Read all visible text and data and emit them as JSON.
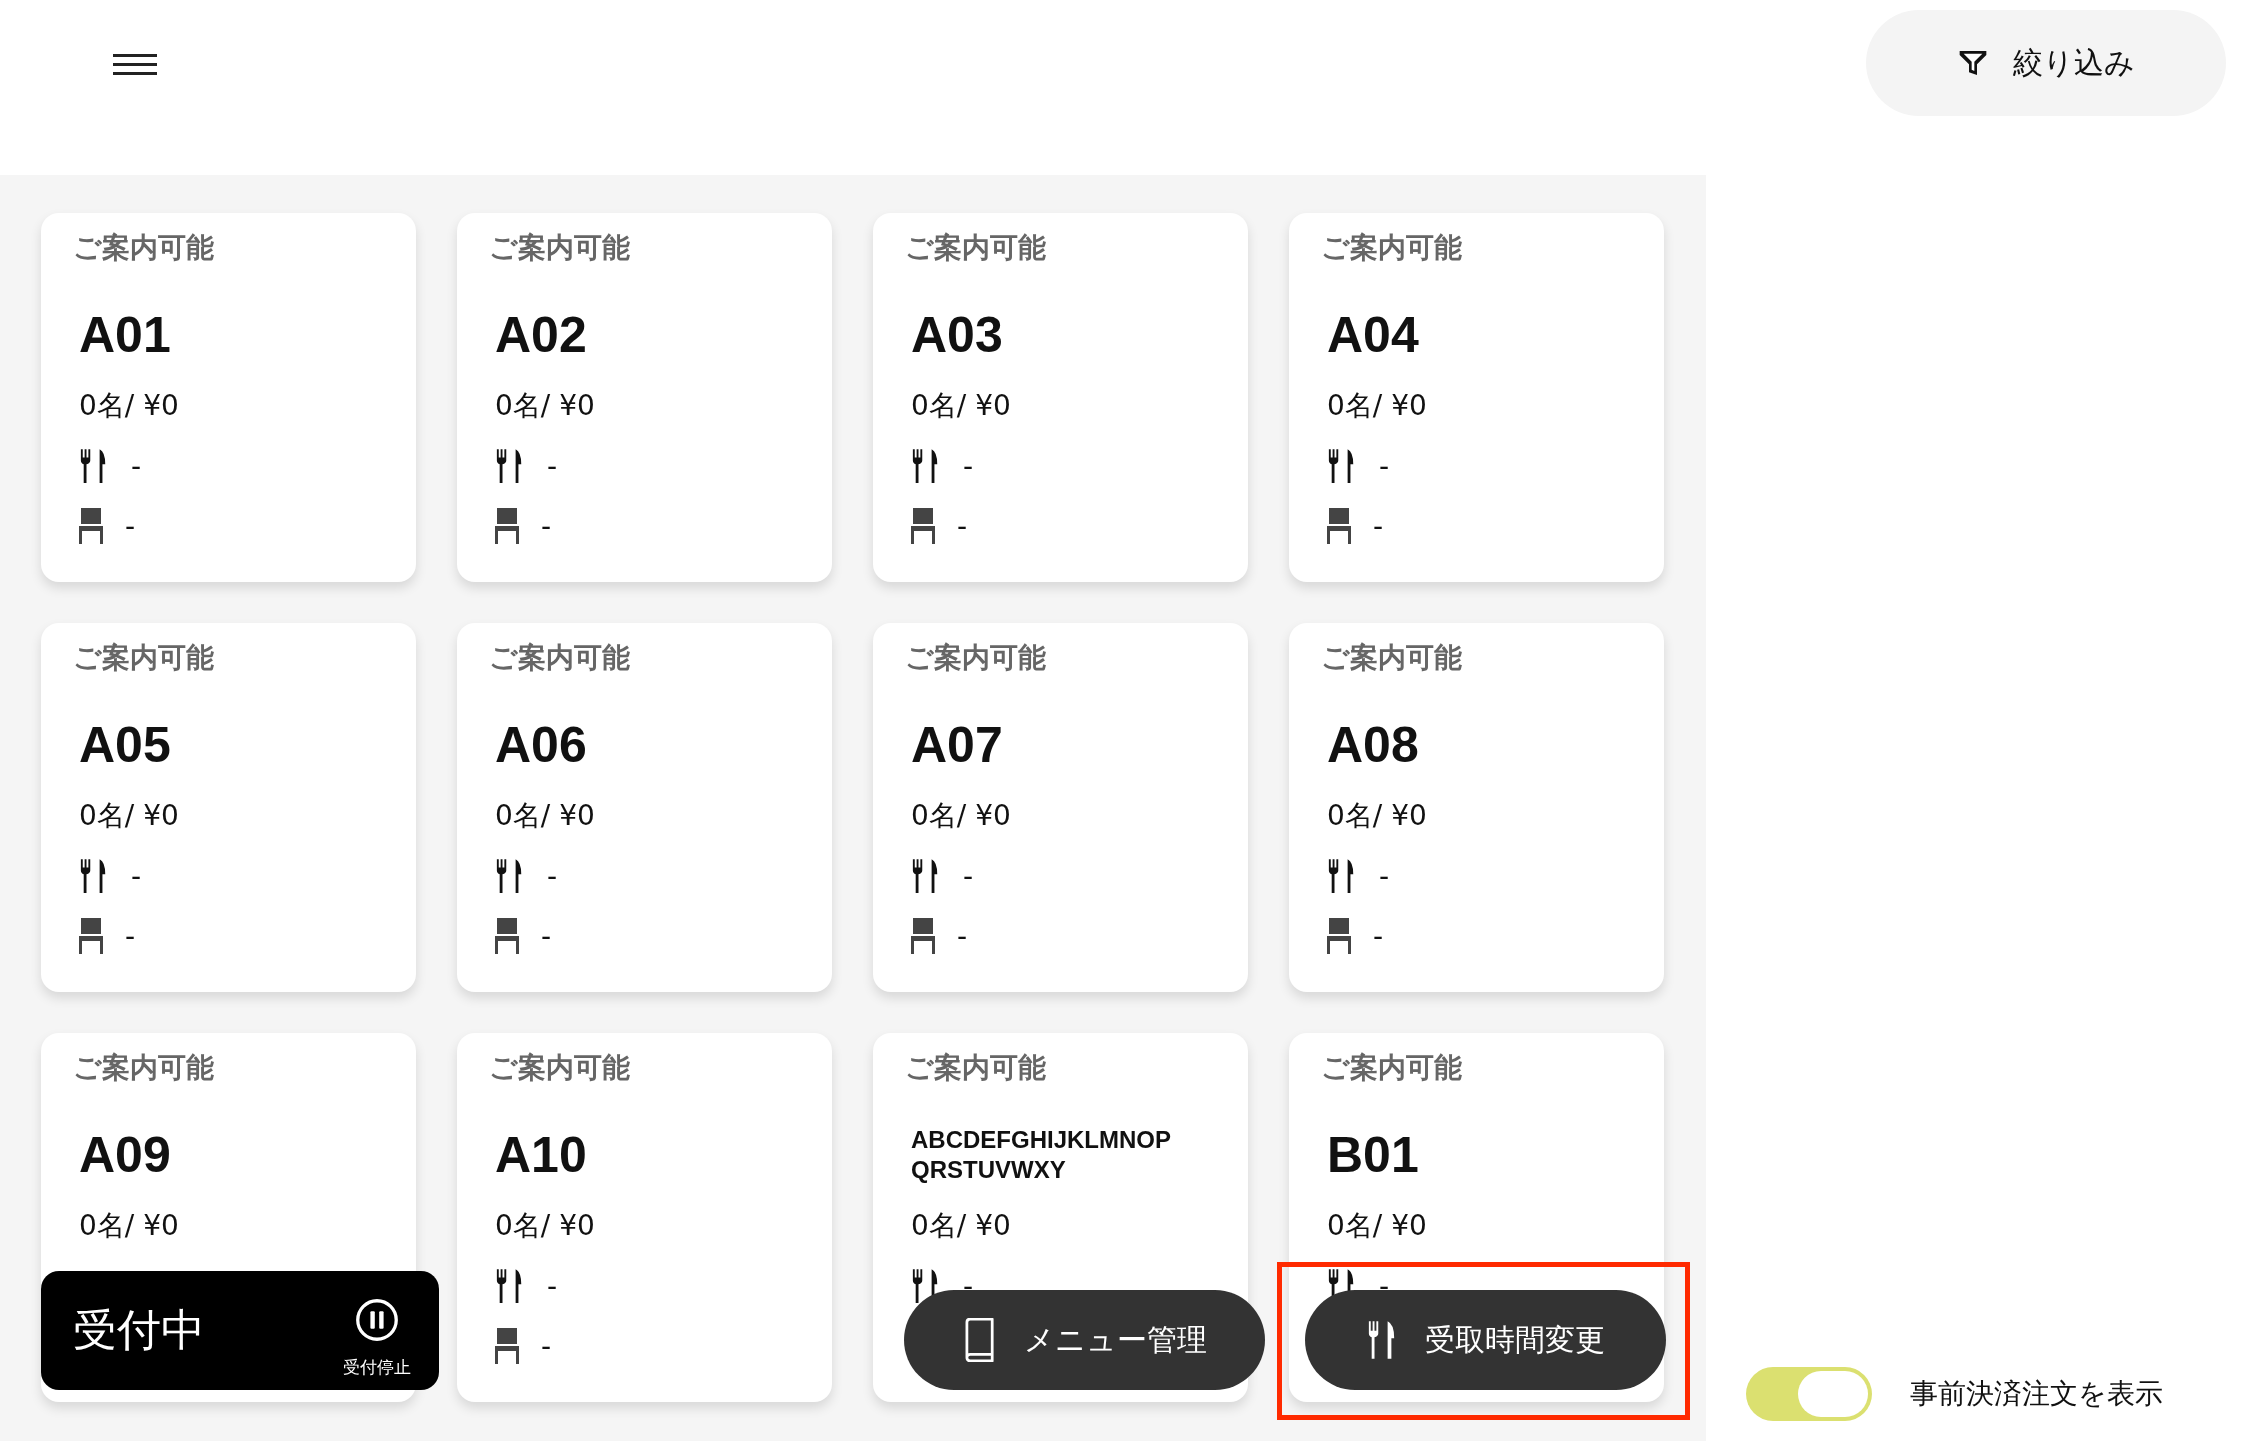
{
  "header": {
    "filter_button": {
      "label": "絞り込み"
    }
  },
  "tables": [
    {
      "status": "ご案内可能",
      "name": "A01",
      "kind": "standard",
      "summary": "0名/ ¥0",
      "meal": "-",
      "seat": "-"
    },
    {
      "status": "ご案内可能",
      "name": "A02",
      "kind": "standard",
      "summary": "0名/ ¥0",
      "meal": "-",
      "seat": "-"
    },
    {
      "status": "ご案内可能",
      "name": "A03",
      "kind": "standard",
      "summary": "0名/ ¥0",
      "meal": "-",
      "seat": "-"
    },
    {
      "status": "ご案内可能",
      "name": "A04",
      "kind": "standard",
      "summary": "0名/ ¥0",
      "meal": "-",
      "seat": "-"
    },
    {
      "status": "ご案内可能",
      "name": "A05",
      "kind": "standard",
      "summary": "0名/ ¥0",
      "meal": "-",
      "seat": "-"
    },
    {
      "status": "ご案内可能",
      "name": "A06",
      "kind": "standard",
      "summary": "0名/ ¥0",
      "meal": "-",
      "seat": "-"
    },
    {
      "status": "ご案内可能",
      "name": "A07",
      "kind": "standard",
      "summary": "0名/ ¥0",
      "meal": "-",
      "seat": "-"
    },
    {
      "status": "ご案内可能",
      "name": "A08",
      "kind": "standard",
      "summary": "0名/ ¥0",
      "meal": "-",
      "seat": "-"
    },
    {
      "status": "ご案内可能",
      "name": "A09",
      "kind": "standard",
      "summary": "0名/ ¥0"
    },
    {
      "status": "ご案内可能",
      "name": "A10",
      "kind": "standard",
      "summary": "0名/ ¥0",
      "meal": "-",
      "seat": "-"
    },
    {
      "status": "ご案内可能",
      "name": "ABCDEFGHIJKLMNOP QRSTUVWXY",
      "kind": "long",
      "summary": "0名/ ¥0",
      "meal": "-"
    },
    {
      "status": "ご案内可能",
      "name": "B01",
      "kind": "standard",
      "summary": "0名/ ¥0",
      "meal": "-"
    }
  ],
  "reception": {
    "label": "受付中",
    "action": "受付停止"
  },
  "floating_buttons": [
    {
      "kind": "menu",
      "label": "メニュー管理",
      "highlighted": false
    },
    {
      "kind": "pickup",
      "label": "受取時間変更",
      "highlighted": true
    }
  ],
  "prepaid_toggle": {
    "label": "事前決済注文を表示",
    "on": true
  }
}
